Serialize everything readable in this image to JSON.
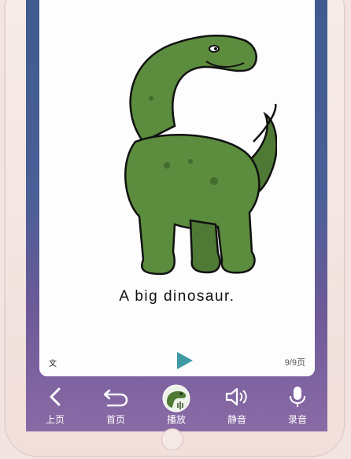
{
  "book": {
    "caption": "A big dinosaur.",
    "text_toggle_label": "文",
    "page_counter": "9/9页"
  },
  "toolbar": {
    "items": [
      {
        "id": "prev",
        "label": "上页",
        "icon": "chevron-left-icon"
      },
      {
        "id": "home",
        "label": "首页",
        "icon": "return-arrow-icon"
      },
      {
        "id": "play",
        "label": "播放",
        "icon": "dinosaur-avatar-icon"
      },
      {
        "id": "mute",
        "label": "静音",
        "icon": "speaker-icon"
      },
      {
        "id": "record",
        "label": "录音",
        "icon": "microphone-icon"
      }
    ]
  },
  "colors": {
    "play_accent": "#3e9aa3",
    "dino_green": "#5c8c3e",
    "dino_belly": "#4f7a35"
  }
}
